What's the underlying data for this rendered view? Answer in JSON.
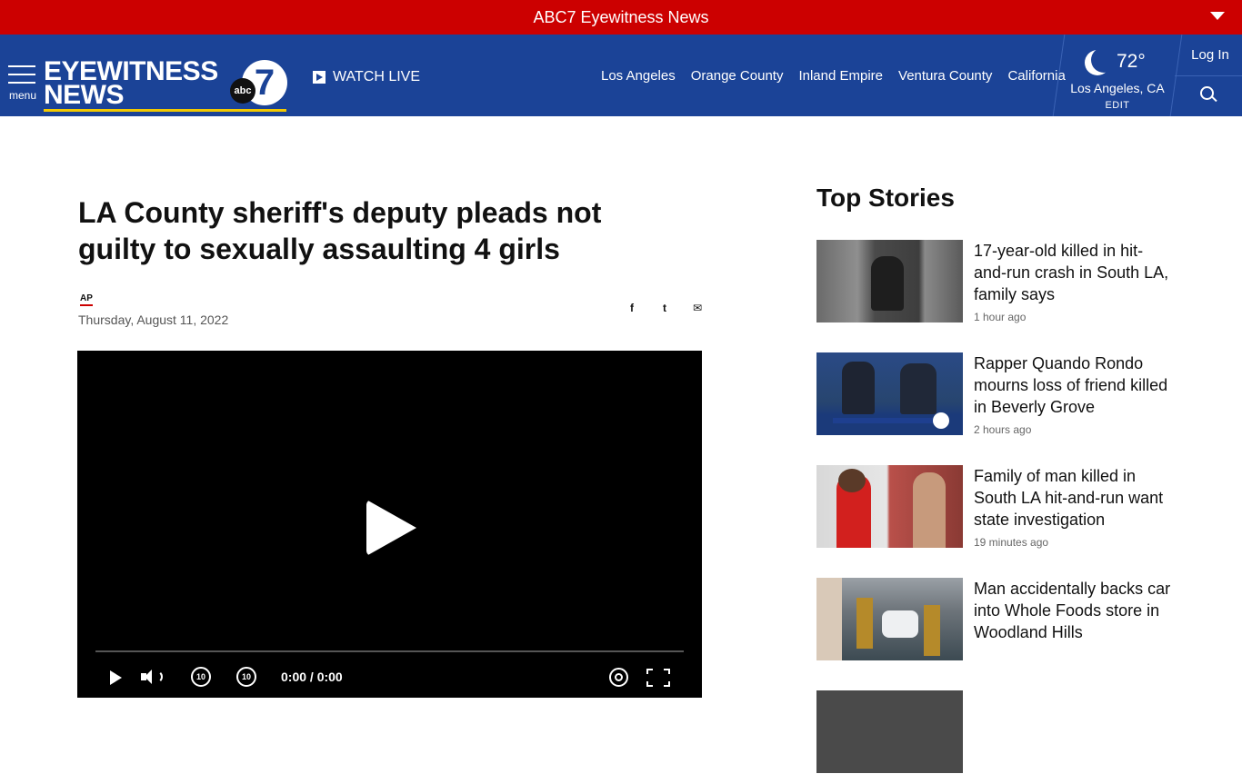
{
  "topbar": {
    "title": "ABC7 Eyewitness News"
  },
  "nav": {
    "menu_label": "menu",
    "logo_line1": "EYEWITNESS",
    "logo_line2": "NEWS",
    "logo_badge": "7",
    "logo_abc": "abc",
    "watch_live": "WATCH LIVE",
    "links": [
      "Los Angeles",
      "Orange County",
      "Inland Empire",
      "Ventura County",
      "California"
    ],
    "weather": {
      "temp": "72°",
      "location": "Los Angeles, CA",
      "edit": "EDIT",
      "icon": "moon-stars-icon"
    },
    "login": "Log In",
    "search_icon": "search-icon"
  },
  "article": {
    "headline": "LA County sheriff's deputy pleads not guilty to sexually assaulting 4 girls",
    "source": "AP",
    "date": "Thursday, August 11, 2022",
    "share": {
      "facebook": "f",
      "twitter": "t",
      "email": "✉"
    },
    "video": {
      "time": "0:00 / 0:00",
      "skip_back": "10",
      "skip_forward": "10"
    }
  },
  "top_stories": {
    "title": "Top Stories",
    "items": [
      {
        "headline": "17-year-old killed in hit-and-run crash in South LA, family says",
        "ago": "1 hour ago"
      },
      {
        "headline": "Rapper Quando Rondo mourns loss of friend killed in Beverly Grove",
        "ago": "2 hours ago"
      },
      {
        "headline": "Family of man killed in South LA hit-and-run want state investigation",
        "ago": "19 minutes ago"
      },
      {
        "headline": "Man accidentally backs car into Whole Foods store in Woodland Hills",
        "ago": ""
      }
    ]
  },
  "colors": {
    "red": "#cc0000",
    "navy": "#1b4397",
    "gold": "#f2c900"
  }
}
